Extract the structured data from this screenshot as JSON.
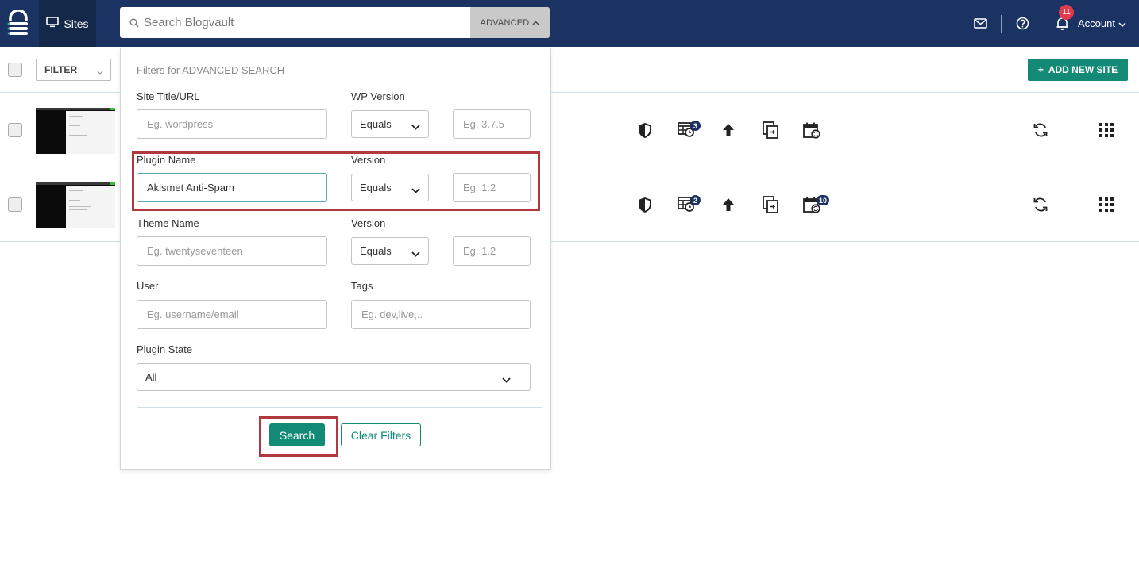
{
  "nav": {
    "sites_label": "Sites",
    "search_placeholder": "Search Blogvault",
    "advanced_label": "ADVANCED",
    "notification_count": "11",
    "account_label": "Account"
  },
  "toolbar": {
    "filter_label": "FILTER",
    "add_site_label": "ADD NEW SITE"
  },
  "sites": [
    {
      "backup_count": "3",
      "schedule_count": ""
    },
    {
      "backup_count": "2",
      "schedule_count": "10"
    }
  ],
  "advanced_search": {
    "title": "Filters for ADVANCED SEARCH",
    "site_title_label": "Site Title/URL",
    "site_title_placeholder": "Eg. wordpress",
    "wp_version_label": "WP Version",
    "wp_version_op": "Equals",
    "wp_version_placeholder": "Eg. 3.7.5",
    "plugin_name_label": "Plugin Name",
    "plugin_name_value": "Akismet Anti-Spam",
    "plugin_version_label": "Version",
    "plugin_version_op": "Equals",
    "plugin_version_placeholder": "Eg. 1.2",
    "theme_name_label": "Theme Name",
    "theme_name_placeholder": "Eg. twentyseventeen",
    "theme_version_label": "Version",
    "theme_version_op": "Equals",
    "theme_version_placeholder": "Eg. 1.2",
    "user_label": "User",
    "user_placeholder": "Eg. username/email",
    "tags_label": "Tags",
    "tags_placeholder": "Eg. dev,live,..",
    "plugin_state_label": "Plugin State",
    "plugin_state_value": "All",
    "search_button": "Search",
    "clear_button": "Clear Filters"
  },
  "colors": {
    "nav_bg": "#1b3363",
    "accent": "#128a76",
    "highlight": "#b0393f",
    "badge": "#e23a4f"
  }
}
